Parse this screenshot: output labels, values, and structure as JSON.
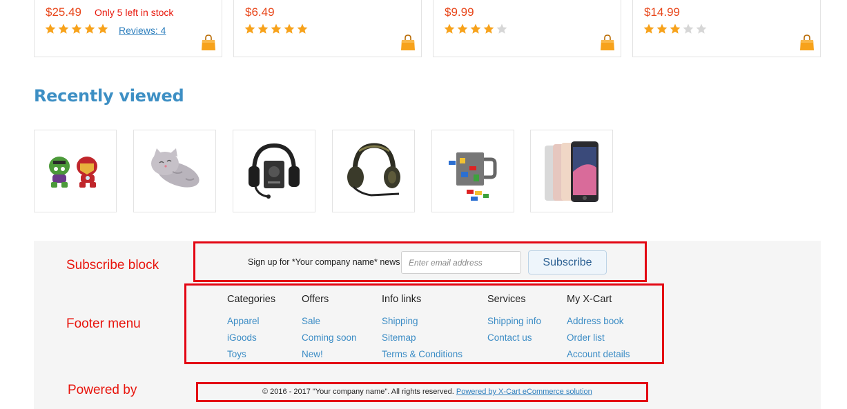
{
  "products": [
    {
      "price": "$25.49",
      "stock": "Only 5 left in stock",
      "rating": 5,
      "reviews": "Reviews: 4"
    },
    {
      "price": "$6.49",
      "stock": "",
      "rating": 5,
      "reviews": ""
    },
    {
      "price": "$9.99",
      "stock": "",
      "rating": 4,
      "reviews": ""
    },
    {
      "price": "$14.99",
      "stock": "",
      "rating": 3,
      "reviews": ""
    }
  ],
  "recently_viewed": {
    "title": "Recently viewed",
    "items": [
      "hulk-ironman-plush-image",
      "cat-plush-image",
      "headset-amp-image",
      "green-headset-image",
      "lego-mug-image",
      "smartphones-image"
    ]
  },
  "annotations": {
    "subscribe": "Subscribe block",
    "footer_menu": "Footer menu",
    "powered_by": "Powered by"
  },
  "subscribe": {
    "text": "Sign up for *Your company name* news",
    "placeholder": "Enter email address",
    "button": "Subscribe"
  },
  "footer_menu": [
    {
      "title": "Categories",
      "links": [
        "Apparel",
        "iGoods",
        "Toys"
      ]
    },
    {
      "title": "Offers",
      "links": [
        "Sale",
        "Coming soon",
        "New!"
      ]
    },
    {
      "title": "Info links",
      "links": [
        "Shipping",
        "Sitemap",
        "Terms & Conditions"
      ]
    },
    {
      "title": "Services",
      "links": [
        "Shipping info",
        "Contact us"
      ]
    },
    {
      "title": "My X-Cart",
      "links": [
        "Address book",
        "Order list",
        "Account details"
      ]
    }
  ],
  "footer": {
    "copyright": "© 2016 - 2017 \"Your company name\". All rights reserved.",
    "powered_link": "Powered by X-Cart eCommerce solution"
  },
  "colors": {
    "price": "#e8461a",
    "star_on": "#f7a21b",
    "star_off": "#d6d6d6",
    "link": "#3b8cc5",
    "annotation_red": "#e30613"
  }
}
